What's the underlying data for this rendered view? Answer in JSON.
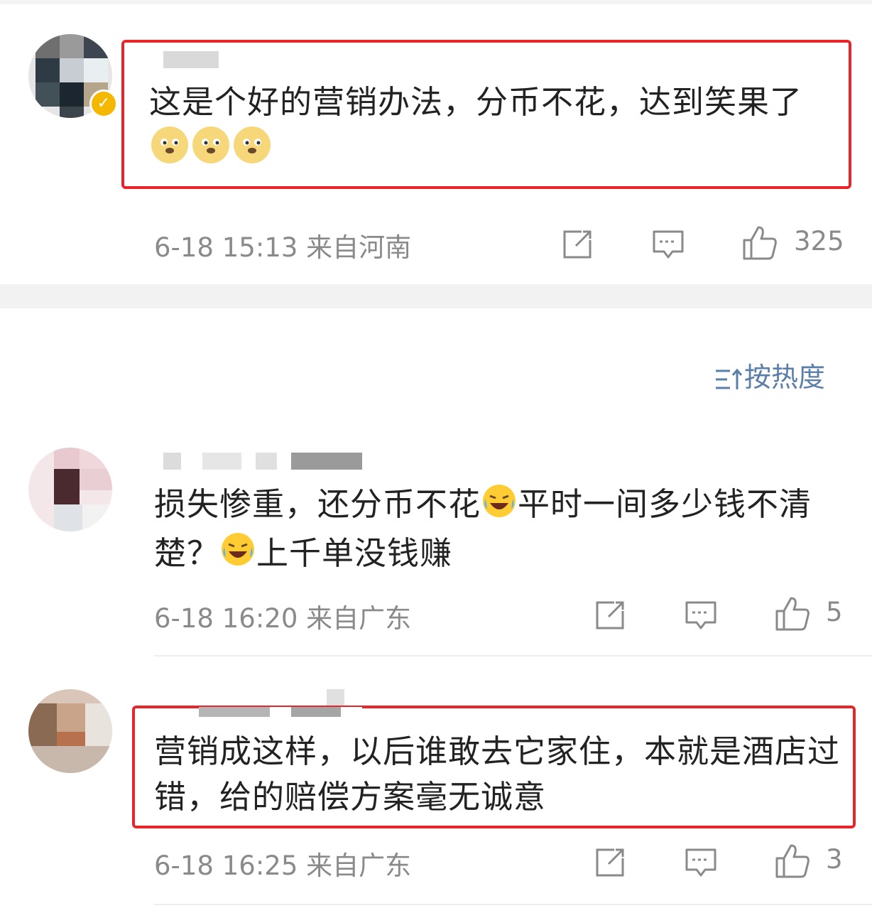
{
  "comments": [
    {
      "text": "这是个好的营销办法，分币不花，达到笑果了",
      "emojis": [
        "doge-emoji",
        "doge-emoji",
        "doge-emoji"
      ],
      "time": "6-18 15:13",
      "location": "来自河南",
      "likes": "325"
    },
    {
      "text_part1": "损失惨重，还分币不花",
      "text_part2": "平时一间多少钱不清楚？",
      "text_part3": "上千单没钱赚",
      "time": "6-18 16:20",
      "location": "来自广东",
      "likes": "5"
    },
    {
      "text": "营销成这样，以后谁敢去它家住，本就是酒店过错，给的赔偿方案毫无诚意",
      "time": "6-18 16:25",
      "location": "来自广东",
      "likes": "3"
    }
  ],
  "sort": {
    "label": "按热度",
    "icon": "sort-icon"
  },
  "colors": {
    "highlight": "#e8262a",
    "link": "#5b7fa8",
    "meta": "#8a8a8a",
    "badge": "#f5b800"
  }
}
